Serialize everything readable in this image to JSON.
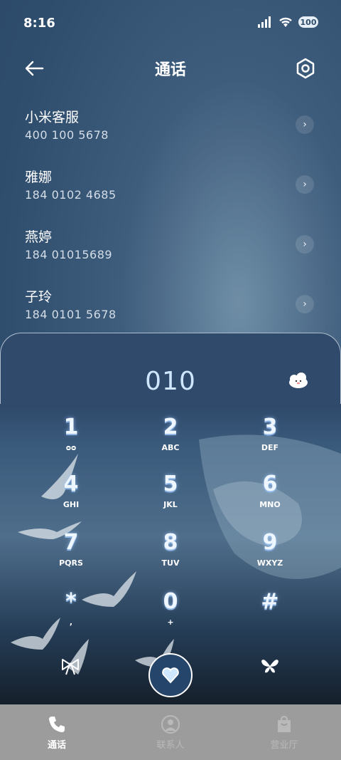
{
  "status_bar": {
    "time": "8:16",
    "battery": "100"
  },
  "header": {
    "title": "通话"
  },
  "contacts": [
    {
      "name": "小米客服",
      "number": "400 100 5678"
    },
    {
      "name": "雅娜",
      "number": "184 0102 4685"
    },
    {
      "name": "燕婷",
      "number": "184 01015689"
    },
    {
      "name": "子玲",
      "number": "184 0101 5678"
    }
  ],
  "dialer": {
    "input": "010"
  },
  "keypad": [
    {
      "digit": "1",
      "letters": "ᴑᴑ"
    },
    {
      "digit": "2",
      "letters": "ABC"
    },
    {
      "digit": "3",
      "letters": "DEF"
    },
    {
      "digit": "4",
      "letters": "GHI"
    },
    {
      "digit": "5",
      "letters": "JKL"
    },
    {
      "digit": "6",
      "letters": "MNO"
    },
    {
      "digit": "7",
      "letters": "PQRS"
    },
    {
      "digit": "8",
      "letters": "TUV"
    },
    {
      "digit": "9",
      "letters": "WXYZ"
    },
    {
      "digit": "*",
      "letters": ","
    },
    {
      "digit": "0",
      "letters": "+"
    },
    {
      "digit": "#",
      "letters": ""
    }
  ],
  "bottom_nav": [
    {
      "label": "通话",
      "icon": "phone-icon",
      "active": true
    },
    {
      "label": "联系人",
      "icon": "person-icon",
      "active": false
    },
    {
      "label": "营业厅",
      "icon": "store-icon",
      "active": false
    }
  ],
  "colors": {
    "accent": "#cfe6ff",
    "nav_bg": "#9c9c9c",
    "nav_inactive": "#b9b9b9"
  }
}
